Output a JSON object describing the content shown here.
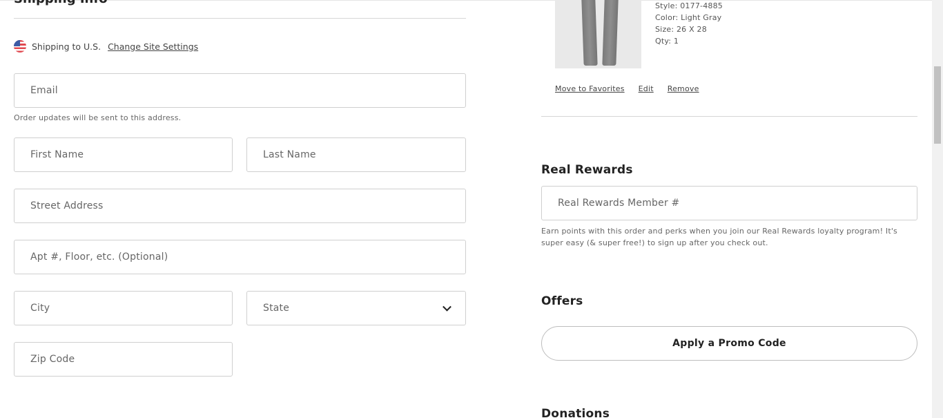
{
  "shipping": {
    "title": "Shipping Info",
    "shipping_to": "Shipping to U.S.",
    "change_site_settings": "Change Site Settings",
    "email_placeholder": "Email",
    "email_hint": "Order updates will be sent to this address.",
    "first_name_placeholder": "First Name",
    "last_name_placeholder": "Last Name",
    "street_placeholder": "Street Address",
    "apt_placeholder": "Apt #, Floor, etc. (Optional)",
    "city_placeholder": "City",
    "state_placeholder": "State",
    "zip_placeholder": "Zip Code"
  },
  "product": {
    "style": "Style: 0177-4885",
    "color": "Color: Light Gray",
    "size": "Size: 26 X 28",
    "qty": "Qty: 1",
    "move_to_favorites": "Move to Favorites",
    "edit": "Edit",
    "remove": "Remove"
  },
  "rewards": {
    "title": "Real Rewards",
    "member_placeholder": "Real Rewards Member #",
    "note": "Earn points with this order and perks when you join our Real Rewards loyalty program! It's super easy (& super free!) to sign up after you check out."
  },
  "offers": {
    "title": "Offers",
    "promo_button": "Apply a Promo Code"
  },
  "donations": {
    "title": "Donations"
  }
}
